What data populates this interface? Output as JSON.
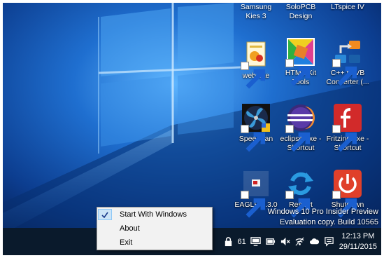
{
  "desktop": {
    "top_labels": [
      {
        "id": "samsung-kies",
        "lines": [
          "Samsung",
          "Kies 3"
        ]
      },
      {
        "id": "solopcb",
        "lines": [
          "SoloPCB",
          "Design"
        ]
      },
      {
        "id": "ltspice",
        "lines": [
          "LTspice IV",
          ""
        ]
      }
    ],
    "icons": [
      {
        "id": "web-site",
        "lines": [
          "web site",
          ""
        ]
      },
      {
        "id": "html-kit",
        "lines": [
          "HTML-Kit",
          "Tools"
        ]
      },
      {
        "id": "cpp-to-vb",
        "lines": [
          "C++ to VB",
          "Converter (..."
        ]
      },
      {
        "id": "speedfan",
        "lines": [
          "SpeedFan",
          ""
        ]
      },
      {
        "id": "eclipse",
        "lines": [
          "eclipse.exe -",
          "Shortcut"
        ]
      },
      {
        "id": "fritzing",
        "lines": [
          "Fritzing.exe -",
          "Shortcut"
        ]
      },
      {
        "id": "eagle",
        "lines": [
          "EAGLE 7.3.0",
          ""
        ]
      },
      {
        "id": "restart",
        "lines": [
          "Restart",
          ""
        ]
      },
      {
        "id": "shutdown",
        "lines": [
          "Shutdown",
          ""
        ]
      }
    ]
  },
  "watermark": {
    "line1": "Windows 10 Pro Insider Preview",
    "line2": "Evaluation copy. Build 10565"
  },
  "context_menu": {
    "items": [
      {
        "label": "Start With Windows",
        "checked": true
      },
      {
        "label": "About",
        "checked": false
      },
      {
        "label": "Exit",
        "checked": false
      }
    ]
  },
  "tray": {
    "badge_count": "61",
    "time": "12:13 PM",
    "date": "29/11/2015"
  },
  "colors": {
    "taskbar": "#0a1a2c",
    "menu_background": "#f2f2f2",
    "menu_check_highlight": "#cce4f7"
  }
}
